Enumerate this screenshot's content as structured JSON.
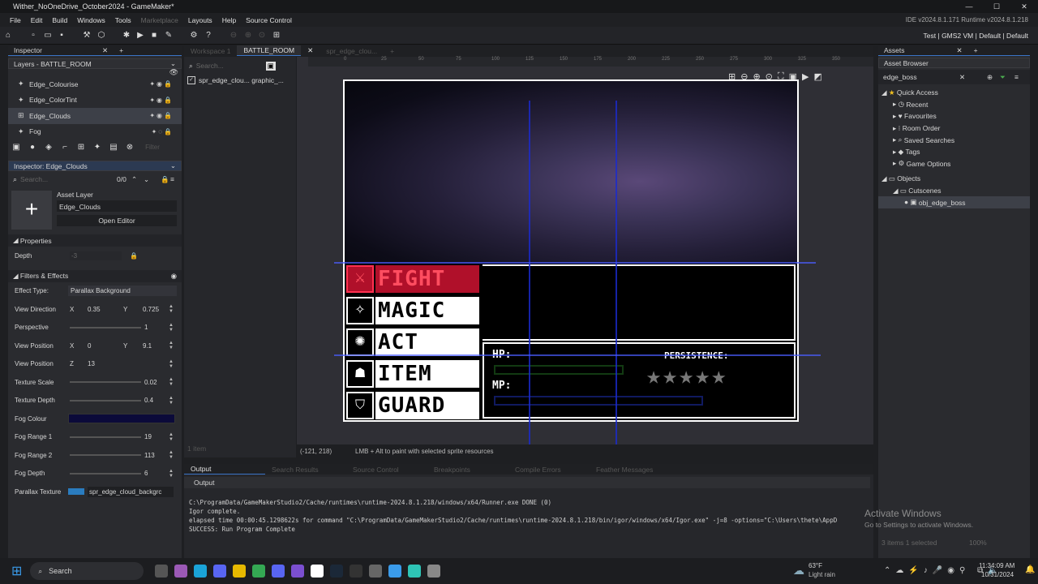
{
  "window": {
    "title": "Wither_NoOneDrive_October2024 - GameMaker*",
    "min": "—",
    "max": "☐",
    "close": "✕"
  },
  "menu": {
    "items": [
      "File",
      "Edit",
      "Build",
      "Windows",
      "Tools",
      "Marketplace",
      "Layouts",
      "Help",
      "Source Control"
    ],
    "version": "IDE v2024.8.1.171  Runtime v2024.8.1.218"
  },
  "config": {
    "text": "Test  |  GMS2 VM  |  Default  |  Default"
  },
  "inspector": {
    "tab": "Inspector",
    "layers_title": "Layers - BATTLE_ROOM",
    "layers": [
      "Edge_Colourise",
      "Edge_ColorTint",
      "Edge_Clouds",
      "Fog"
    ],
    "filter_placeholder": "Filter",
    "inspector_title": "Inspector: Edge_Clouds",
    "search_placeholder": "Search...",
    "search_count": "0/0",
    "asset_layer_label": "Asset Layer",
    "layer_name": "Edge_Clouds",
    "open_editor": "Open Editor",
    "properties": "Properties",
    "depth_label": "Depth",
    "depth_value": "-3",
    "filters": "Filters & Effects",
    "effect_type_label": "Effect Type:",
    "effect_type": "Parallax Background",
    "view_direction": "View Direction",
    "vd_x": "0.35",
    "vd_y": "0.725",
    "perspective": "Perspective",
    "perspective_val": "1",
    "view_position": "View Position",
    "vp_x": "0",
    "vp_y": "9.1",
    "view_position_z": "View Position",
    "vp_z": "13",
    "texture_scale": "Texture Scale",
    "ts_val": "0.02",
    "texture_depth": "Texture Depth",
    "td_val": "0.4",
    "fog_colour": "Fog Colour",
    "fog_range1": "Fog Range 1",
    "fr1": "19",
    "fog_range2": "Fog Range 2",
    "fr2": "113",
    "fog_depth": "Fog Depth",
    "fd": "6",
    "parallax_texture": "Parallax Texture",
    "pt_val": "spr_edge_cloud_backgrc",
    "x": "X",
    "y": "Y",
    "z": "Z"
  },
  "tabs": [
    "Workspace 1",
    "BATTLE_ROOM",
    "spr_edge_clou..."
  ],
  "room": {
    "search_placeholder": "Search...",
    "item": "spr_edge_clou...  graphic_...",
    "item_count": "1 item",
    "coords": "(-121, 218)",
    "hint": "LMB + Alt to paint with selected sprite resources",
    "ruler": [
      "0",
      "25",
      "50",
      "75",
      "100",
      "125",
      "150",
      "175",
      "200",
      "225",
      "250",
      "275",
      "300",
      "325",
      "350"
    ]
  },
  "game": {
    "menu": [
      "FIGHT",
      "MAGIC",
      "ACT",
      "ITEM",
      "GUARD"
    ],
    "icons": [
      "⚔",
      "✧",
      "✺",
      "☗",
      "⛉"
    ],
    "hp": "HP:",
    "mp": "MP:",
    "persistence": "PERSISTENCE:",
    "stars": "★★★★★"
  },
  "output": {
    "tabs": [
      "Output",
      "Search Results",
      "Source Control",
      "Breakpoints",
      "Compile Errors",
      "Feather Messages"
    ],
    "header": "Output",
    "lines": [
      "C:\\ProgramData/GameMakerStudio2/Cache/runtimes\\runtime-2024.8.1.218/windows/x64/Runner.exe DONE (0)",
      "Igor complete.",
      "elapsed time 00:00:45.1298622s for command \"C:\\ProgramData/GameMakerStudio2/Cache/runtimes\\runtime-2024.8.1.218/bin/igor/windows/x64/Igor.exe\" -j=8  -options=\"C:\\Users\\thete\\AppD",
      "SUCCESS: Run Program Complete"
    ]
  },
  "assets": {
    "tab": "Assets",
    "browser": "Asset Browser",
    "search": "edge_boss",
    "tree": [
      "Quick Access",
      "Recent",
      "Favourites",
      "Room Order",
      "Saved Searches",
      "Tags",
      "Game Options"
    ],
    "objects": "Objects",
    "cutscenes": "Cutscenes",
    "obj": "obj_edge_boss",
    "footer": "3 items   1 selected",
    "zoom": "100%"
  },
  "watermark": {
    "title": "Activate Windows",
    "sub": "Go to Settings to activate Windows."
  },
  "taskbar": {
    "search": "Search",
    "weather_temp": "63°F",
    "weather": "Light rain",
    "time": "11:34:09 AM",
    "date": "10/31/2024"
  },
  "colors": {
    "accent": "#3b74c7",
    "fight": "#b0102a",
    "fog": "#0b0a3a"
  }
}
